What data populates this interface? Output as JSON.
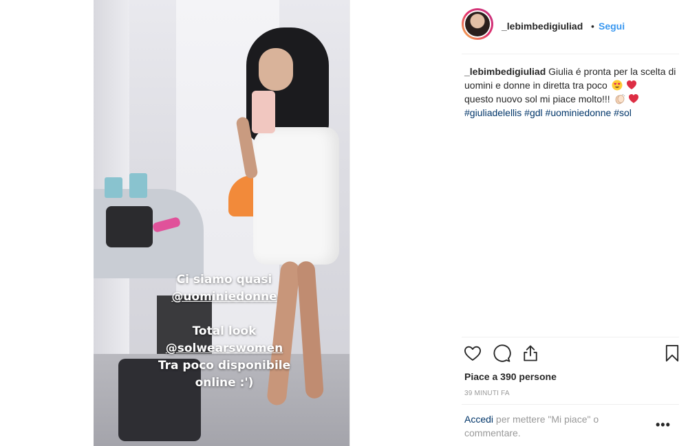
{
  "post": {
    "username": "_lebimbedigiuliad",
    "separator": "•",
    "follow_label": "Segui",
    "caption": {
      "username": "_lebimbedigiuliad",
      "line1": "Giulia é pronta per la scelta di uomini e donne in diretta tra poco",
      "emoji1": "heart-eyes-emoji",
      "emoji2": "red-heart-emoji",
      "line2": "questo nuovo sol mi piace molto!!!",
      "emoji3": "clapping-hands-emoji",
      "emoji4": "red-heart-emoji",
      "hashtags": [
        "#giuliadelellis",
        "#gdl",
        "#uominiedonne",
        "#sol"
      ]
    },
    "likes_text": "Piace a 390 persone",
    "time_ago": "39 MINUTI FA",
    "login_prompt": {
      "link": "Accedi",
      "rest": "per mettere \"Mi piace\" o commentare."
    },
    "more_label": "•••"
  },
  "photo_overlay": {
    "line1": "Ci siamo quasi",
    "line2": "@uominiedonne",
    "line3": "Total look",
    "line4": "@solwearswomen",
    "line5": "Tra poco disponibile",
    "line6": "online :')"
  },
  "icons": {
    "like": "heart-icon",
    "comment": "comment-icon",
    "share": "share-icon",
    "save": "bookmark-icon"
  },
  "colors": {
    "link_blue": "#3897f0",
    "hashtag_blue": "#003569",
    "text": "#262626",
    "muted": "#999999"
  }
}
